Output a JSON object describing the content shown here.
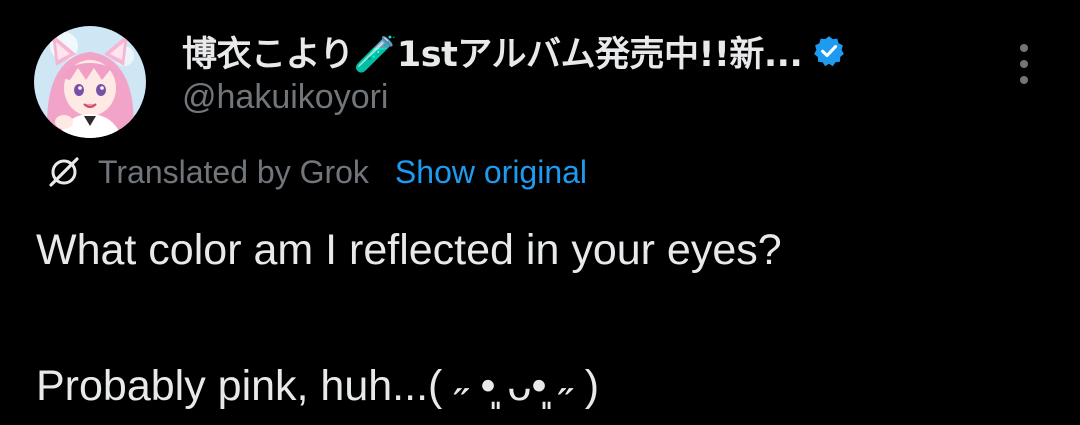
{
  "tweet": {
    "author": {
      "display_name": "博衣こより🧪1stアルバム発売中!!新...",
      "handle": "@hakuikoyori",
      "verified": true,
      "avatar_icon": "avatar-image"
    },
    "translation": {
      "label": "Translated by Grok",
      "show_original_label": "Show original",
      "icon": "grok-icon"
    },
    "text_lines": [
      "What color am I reflected in your eyes?",
      "Probably pink, huh...( ˶ •͈ ᴗ•͈ ˶ )"
    ]
  },
  "colors": {
    "background": "#000000",
    "text_primary": "#e7e9ea",
    "text_secondary": "#71767b",
    "link": "#1d9bf0",
    "verified_badge": "#1d9bf0"
  }
}
